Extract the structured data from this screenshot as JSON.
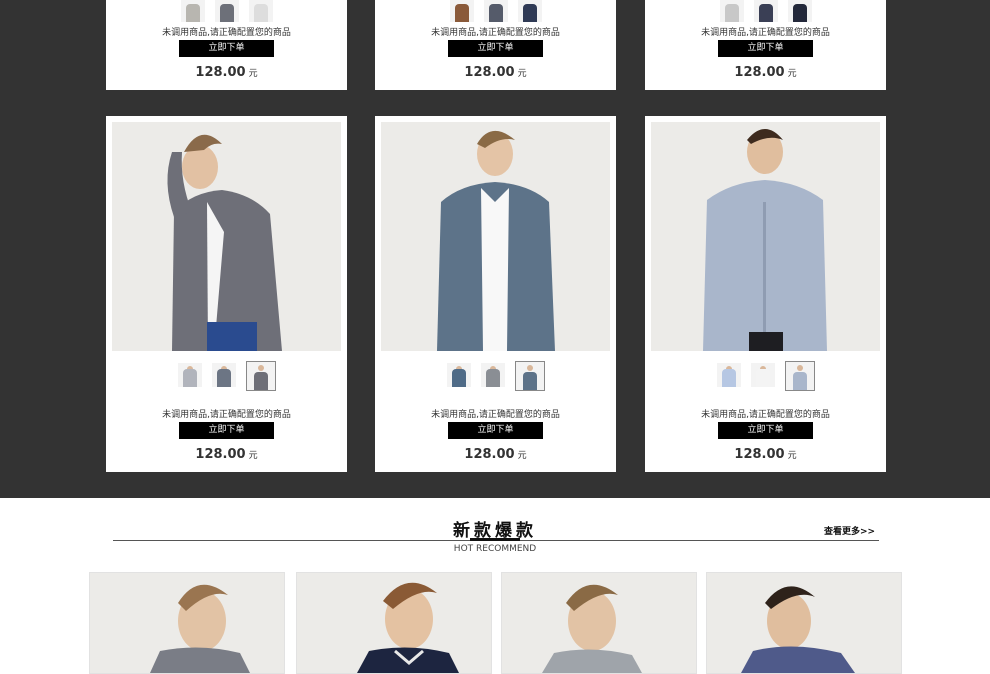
{
  "products_top": [
    {
      "desc": "未调用商品,请正确配置您的商品",
      "buy": "立即下单",
      "price": "128.00",
      "unit": "元"
    },
    {
      "desc": "未调用商品,请正确配置您的商品",
      "buy": "立即下单",
      "price": "128.00",
      "unit": "元"
    },
    {
      "desc": "未调用商品,请正确配置您的商品",
      "buy": "立即下单",
      "price": "128.00",
      "unit": "元"
    }
  ],
  "products": [
    {
      "desc": "未调用商品,请正确配置您的商品",
      "buy": "立即下单",
      "price": "128.00",
      "unit": "元",
      "shirt_color": "#6e6f78",
      "shirt_image": "man-in-grey-check-shirt"
    },
    {
      "desc": "未调用商品,请正确配置您的商品",
      "buy": "立即下单",
      "price": "128.00",
      "unit": "元",
      "shirt_color": "#5d7389",
      "shirt_image": "man-in-blue-check-shirt"
    },
    {
      "desc": "未调用商品,请正确配置您的商品",
      "buy": "立即下单",
      "price": "128.00",
      "unit": "元",
      "shirt_color": "#a9b6cb",
      "shirt_image": "man-in-light-blue-shirt"
    }
  ],
  "section": {
    "title": "新款爆款",
    "subtitle": "HOT RECOMMEND",
    "more": "查看更多>>"
  },
  "colors": {
    "dark_bg": "#333333",
    "button": "#000000"
  }
}
